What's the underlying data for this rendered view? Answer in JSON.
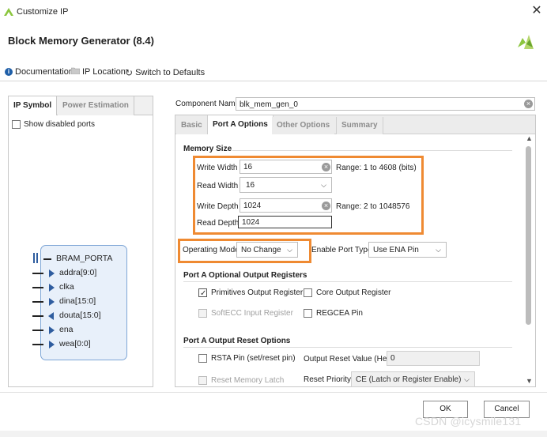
{
  "window": {
    "title": "Customize IP",
    "close_glyph": "✕"
  },
  "header": {
    "title": "Block Memory Generator (8.4)",
    "toolbar": {
      "documentation": "Documentation",
      "ip_location": "IP Location",
      "switch_defaults": "Switch to Defaults"
    },
    "logo_color": "#8cc63f"
  },
  "left_panel": {
    "tabs": [
      "IP Symbol",
      "Power Estimation"
    ],
    "show_disabled_ports": "Show disabled ports",
    "ip_symbol": {
      "port_group": "BRAM_PORTA",
      "ports": [
        {
          "name": "addra[9:0]",
          "dir": "in"
        },
        {
          "name": "clka",
          "dir": "in"
        },
        {
          "name": "dina[15:0]",
          "dir": "in"
        },
        {
          "name": "douta[15:0]",
          "dir": "out"
        },
        {
          "name": "ena",
          "dir": "in"
        },
        {
          "name": "wea[0:0]",
          "dir": "in"
        }
      ]
    }
  },
  "component": {
    "label": "Component Name",
    "value": "blk_mem_gen_0"
  },
  "tabs": [
    "Basic",
    "Port A Options",
    "Other Options",
    "Summary"
  ],
  "memory_size": {
    "title": "Memory Size",
    "write_width": {
      "label": "Write Width",
      "value": "16",
      "range": "Range: 1 to 4608 (bits)"
    },
    "read_width": {
      "label": "Read Width",
      "value": "16"
    },
    "write_depth": {
      "label": "Write Depth",
      "value": "1024",
      "range": "Range: 2 to 1048576"
    },
    "read_depth": {
      "label": "Read Depth",
      "value": "1024"
    }
  },
  "operating_mode": {
    "label": "Operating Mode",
    "value": "No Change"
  },
  "enable_port": {
    "label": "Enable Port Type",
    "value": "Use ENA Pin"
  },
  "optional_outputs": {
    "title": "Port A Optional Output Registers",
    "primitives": {
      "label": "Primitives Output Register",
      "checked": true
    },
    "core": {
      "label": "Core Output Register",
      "checked": false
    },
    "softecc": {
      "label": "SoftECC Input Register",
      "checked": false
    },
    "regcea": {
      "label": "REGCEA Pin",
      "checked": false
    }
  },
  "reset_options": {
    "title": "Port A Output Reset Options",
    "rsta": {
      "label": "RSTA Pin (set/reset pin)"
    },
    "output_reset_value": {
      "label": "Output Reset Value (Hex)",
      "value": "0"
    },
    "reset_memory_latch": {
      "label": "Reset Memory Latch"
    },
    "reset_priority": {
      "label": "Reset Priority",
      "value": "CE (Latch or Register Enable)"
    }
  },
  "buttons": {
    "ok": "OK",
    "cancel": "Cancel"
  },
  "watermark": "CSDN @icysmile131",
  "colors": {
    "highlight": "#ef8a32",
    "ip_block_fill": "#e8f0fa",
    "ip_block_border": "#7ea6d6",
    "port_arrow": "#2f5d9f"
  }
}
